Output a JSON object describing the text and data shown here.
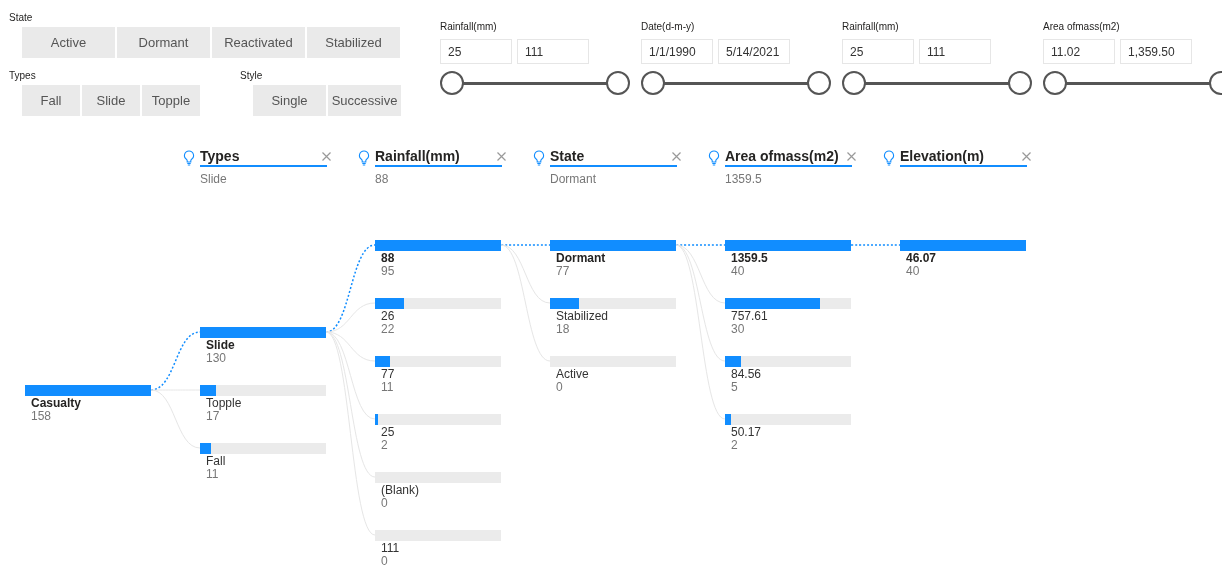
{
  "button_slicers": [
    {
      "title": "State",
      "options": [
        "Active",
        "Dormant",
        "Reactivated",
        "Stabilized"
      ]
    },
    {
      "title": "Types",
      "options": [
        "Fall",
        "Slide",
        "Topple"
      ]
    },
    {
      "title": "Style",
      "options": [
        "Single",
        "Successive"
      ]
    }
  ],
  "range_slicers": [
    {
      "title": "Rainfall(mm)",
      "min": "25",
      "max": "111"
    },
    {
      "title": "Date(d-m-y)",
      "min": "1/1/1990",
      "max": "5/14/2021"
    },
    {
      "title": "Rainfall(mm)",
      "min": "25",
      "max": "111"
    },
    {
      "title": "Area ofmass(m2)",
      "min": "11.02",
      "max": "1,359.50"
    }
  ],
  "decomposition_tree": {
    "root": {
      "label": "Casualty",
      "value": "158",
      "level": 1,
      "selected": true
    },
    "levels": [
      {
        "field": "Types",
        "selection": "Slide",
        "nodes": [
          {
            "label": "Slide",
            "value": "130",
            "level": 1,
            "selected": true
          },
          {
            "label": "Topple",
            "value": "17",
            "level": 0.13,
            "selected": false
          },
          {
            "label": "Fall",
            "value": "11",
            "level": 0.085,
            "selected": false
          }
        ]
      },
      {
        "field": "Rainfall(mm)",
        "selection": "88",
        "nodes": [
          {
            "label": "88",
            "value": "95",
            "level": 1,
            "selected": true
          },
          {
            "label": "26",
            "value": "22",
            "level": 0.23,
            "selected": false
          },
          {
            "label": "77",
            "value": "11",
            "level": 0.116,
            "selected": false
          },
          {
            "label": "25",
            "value": "2",
            "level": 0.021,
            "selected": false
          },
          {
            "label": "(Blank)",
            "value": "0",
            "selected": false
          },
          {
            "label": "111",
            "value": "0",
            "selected": false
          }
        ]
      },
      {
        "field": "State",
        "selection": "Dormant",
        "nodes": [
          {
            "label": "Dormant",
            "value": "77",
            "level": 1,
            "selected": true
          },
          {
            "label": "Stabilized",
            "value": "18",
            "level": 0.234,
            "selected": false
          },
          {
            "label": "Active",
            "value": "0",
            "selected": false
          }
        ]
      },
      {
        "field": "Area ofmass(m2)",
        "selection": "1359.5",
        "nodes": [
          {
            "label": "1359.5",
            "value": "40",
            "level": 1,
            "selected": true
          },
          {
            "label": "757.61",
            "value": "30",
            "level": 0.75,
            "selected": false
          },
          {
            "label": "84.56",
            "value": "5",
            "level": 0.125,
            "selected": false
          },
          {
            "label": "50.17",
            "value": "2",
            "level": 0.05,
            "selected": false
          }
        ]
      },
      {
        "field": "Elevation(m)",
        "nodes": [
          {
            "label": "46.07",
            "value": "40",
            "level": 1,
            "selected": true
          }
        ]
      }
    ]
  }
}
